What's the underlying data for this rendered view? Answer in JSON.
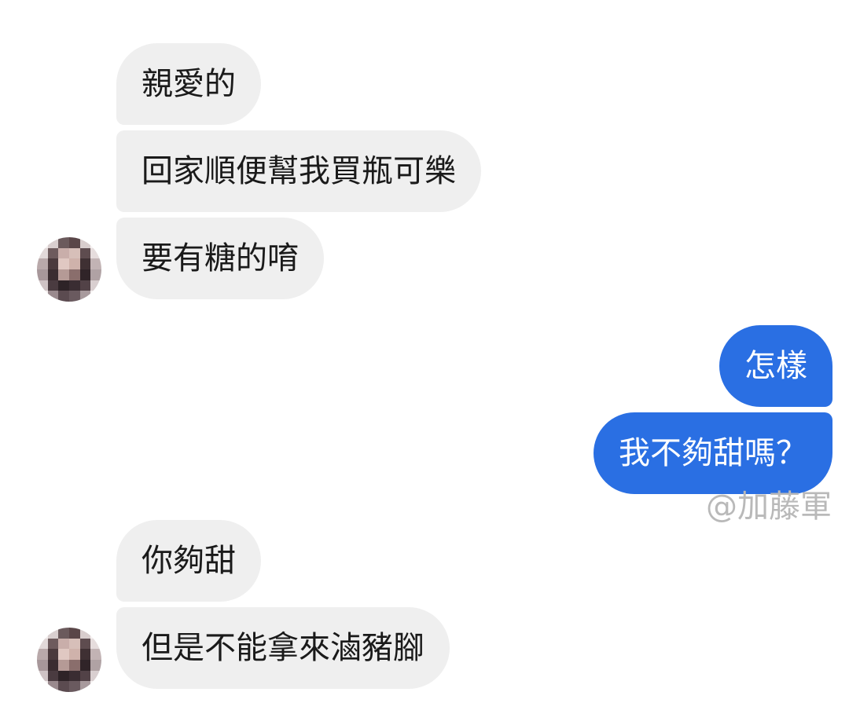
{
  "conversation": {
    "messages": [
      {
        "sender": "them",
        "text": "親愛的"
      },
      {
        "sender": "them",
        "text": "回家順便幫我買瓶可樂"
      },
      {
        "sender": "them",
        "text": "要有糖的唷"
      },
      {
        "sender": "me",
        "text": "怎樣"
      },
      {
        "sender": "me",
        "text": "我不夠甜嗎？"
      },
      {
        "sender": "them",
        "text": "你夠甜"
      },
      {
        "sender": "them",
        "text": "但是不能拿來滷豬腳"
      }
    ]
  },
  "watermark": "@加藤軍",
  "colors": {
    "incoming_bubble": "#efefef",
    "outgoing_bubble": "#2a6fe3",
    "watermark": "#b9b9b9"
  },
  "icons": {
    "avatar": "contact-avatar-pixelated"
  }
}
